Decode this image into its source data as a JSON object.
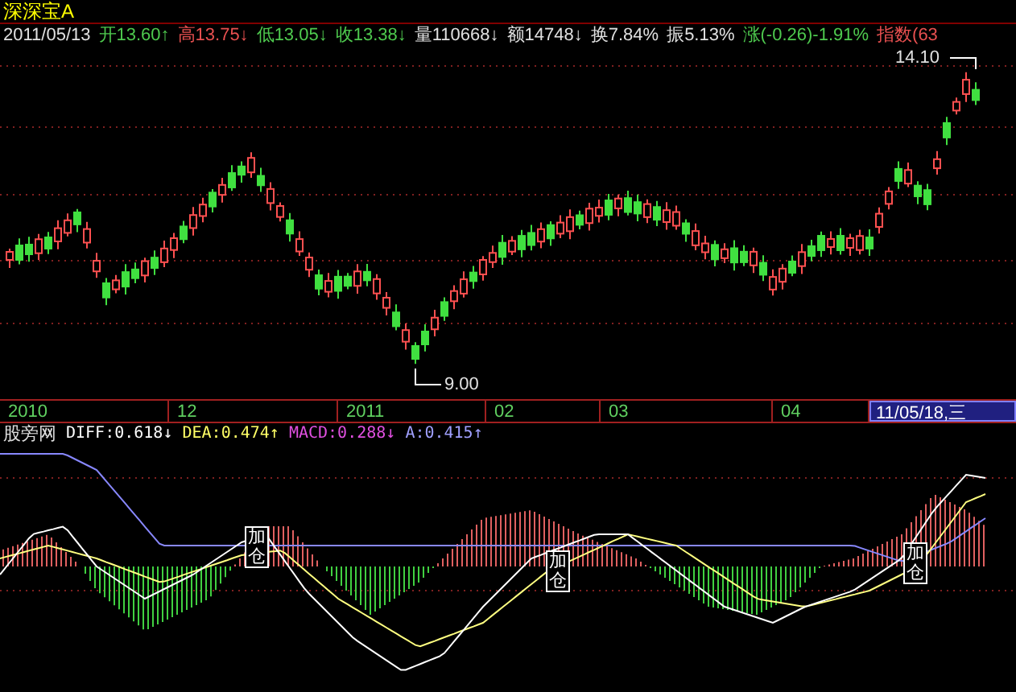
{
  "title": "深深宝A",
  "quote": {
    "date": "2011/05/13",
    "items": [
      {
        "label": "开",
        "value": "13.60",
        "arrow": "↑",
        "color": "#4ec94e"
      },
      {
        "label": "高",
        "value": "13.75",
        "arrow": "↓",
        "color": "#e85050"
      },
      {
        "label": "低",
        "value": "13.05",
        "arrow": "↓",
        "color": "#4ec94e"
      },
      {
        "label": "收",
        "value": "13.38",
        "arrow": "↓",
        "color": "#4ec94e"
      },
      {
        "label": "量",
        "value": "110668",
        "arrow": "↓",
        "color": "#e0e0e0"
      },
      {
        "label": "额",
        "value": "14748",
        "arrow": "↓",
        "color": "#e0e0e0"
      },
      {
        "label": "换",
        "value": "7.84%",
        "color": "#e0e0e0"
      },
      {
        "label": "振",
        "value": "5.13%",
        "color": "#e0e0e0"
      },
      {
        "label": "涨",
        "value": "(-0.26)-1.91%",
        "color": "#4ec94e"
      },
      {
        "label": "指数",
        "value": "(63",
        "color": "#e85050"
      }
    ]
  },
  "price_chart": {
    "high_label": "14.10",
    "low_label": "9.00"
  },
  "time_axis": {
    "labels": [
      "2010",
      "12",
      "2011",
      "02",
      "03",
      "04"
    ],
    "cursor_date": "11/05/18,三"
  },
  "indicator": {
    "name": "股旁网",
    "values": [
      {
        "text": "DIFF:0.618",
        "arrow": "↓",
        "color": "#ffffff"
      },
      {
        "text": "DEA:0.474",
        "arrow": "↑",
        "color": "#ffff66"
      },
      {
        "text": "MACD:0.288",
        "arrow": "↓",
        "color": "#e050e0"
      },
      {
        "text": "A:0.415",
        "arrow": "↑",
        "color": "#a0a0ff"
      }
    ],
    "signals": [
      "加仓",
      "加仓",
      "加仓"
    ]
  }
}
